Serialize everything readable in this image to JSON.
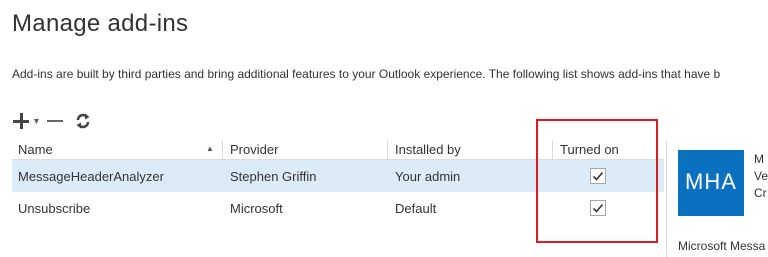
{
  "page": {
    "title": "Manage add-ins",
    "description": "Add-ins are built by third parties and bring additional features to your Outlook experience. The following list shows add-ins that have b"
  },
  "toolbar": {
    "add_icon": "plus-icon",
    "add_dropdown_icon": "chevron-down-icon",
    "remove_icon": "minus-icon",
    "refresh_icon": "refresh-icon"
  },
  "table": {
    "headers": {
      "name": "Name",
      "provider": "Provider",
      "installed_by": "Installed by",
      "turned_on": "Turned on"
    },
    "sort_indicator": "▲",
    "rows": [
      {
        "name": "MessageHeaderAnalyzer",
        "provider": "Stephen Griffin",
        "installed_by": "Your admin",
        "turned_on": true,
        "selected": true
      },
      {
        "name": "Unsubscribe",
        "provider": "Microsoft",
        "installed_by": "Default",
        "turned_on": true,
        "selected": false
      }
    ]
  },
  "details": {
    "tile_text": "MHA",
    "tile_color": "#0a70c0",
    "line1": "M",
    "line2": "Ve",
    "line3": "Cr",
    "full_name": "Microsoft Messa"
  },
  "colors": {
    "selected_row": "#dcebf8",
    "highlight_box": "#e11b1b"
  }
}
